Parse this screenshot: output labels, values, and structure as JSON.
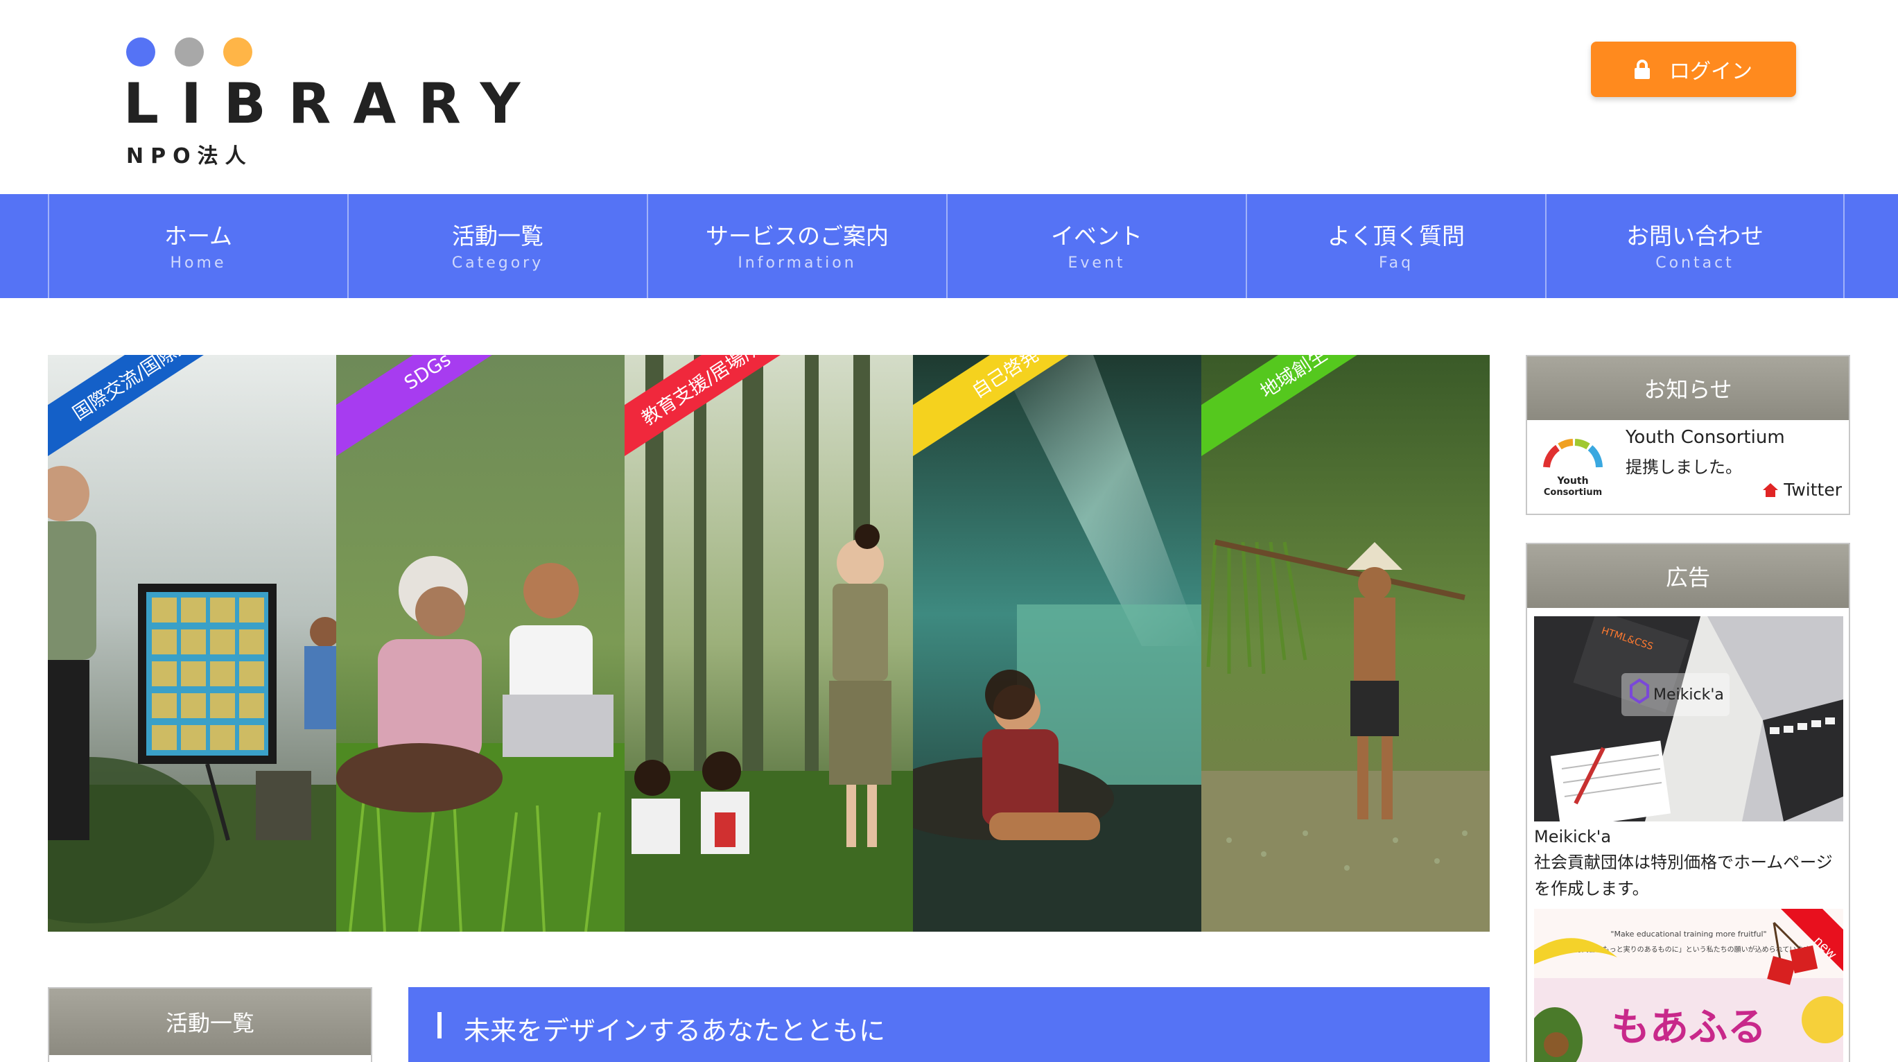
{
  "brand": {
    "name": "LIBRARY",
    "sub": "NPO法人",
    "dot_colors": [
      "#5573f5",
      "#a8a8a8",
      "#ffb547"
    ]
  },
  "header": {
    "login_label": "ログイン",
    "login_icon": "lock-icon",
    "login_color": "#ff8a1e"
  },
  "nav": {
    "color": "#5573f5",
    "items": [
      {
        "jp": "ホーム",
        "en": "Home"
      },
      {
        "jp": "活動一覧",
        "en": "Category"
      },
      {
        "jp": "サービスのご案内",
        "en": "Information"
      },
      {
        "jp": "イベント",
        "en": "Event"
      },
      {
        "jp": "よく頂く質問",
        "en": "Faq"
      },
      {
        "jp": "お問い合わせ",
        "en": "Contact"
      }
    ]
  },
  "hero": {
    "panels": [
      {
        "label": "国際交流/国際支援",
        "ribbon_color": "#1460c8"
      },
      {
        "label": "SDGs",
        "ribbon_color": "#a73cf0"
      },
      {
        "label": "教育支援/居場所作り",
        "ribbon_color": "#f0283c"
      },
      {
        "label": "自己啓発",
        "ribbon_color": "#f5d21e"
      },
      {
        "label": "地域創生",
        "ribbon_color": "#55c81e"
      }
    ]
  },
  "sidebar": {
    "news": {
      "title": "お知らせ",
      "item_title": "Youth Consortium",
      "item_text": "提携しました。",
      "logo_text_1": "Youth",
      "logo_text_2": "Consortium",
      "link_label": "Twitter",
      "link_icon": "house-icon"
    },
    "ads": {
      "title": "広告",
      "items": [
        {
          "name": "Meikick'a",
          "desc": "社会貢献団体は特別価格でホームページを作成します。",
          "img_book": "HTML&CSS",
          "img_brand": "Meikick'a"
        },
        {
          "badge": "new",
          "img_headline": "\"Make educational training more fruitful\"",
          "img_sub": "「教育実習をもっと実りのあるものに」という私たちの願いが込められています。",
          "img_title": "もあふる"
        }
      ]
    }
  },
  "content": {
    "category_title": "活動一覧",
    "headline": "未来をデザインするあなたとともに"
  }
}
